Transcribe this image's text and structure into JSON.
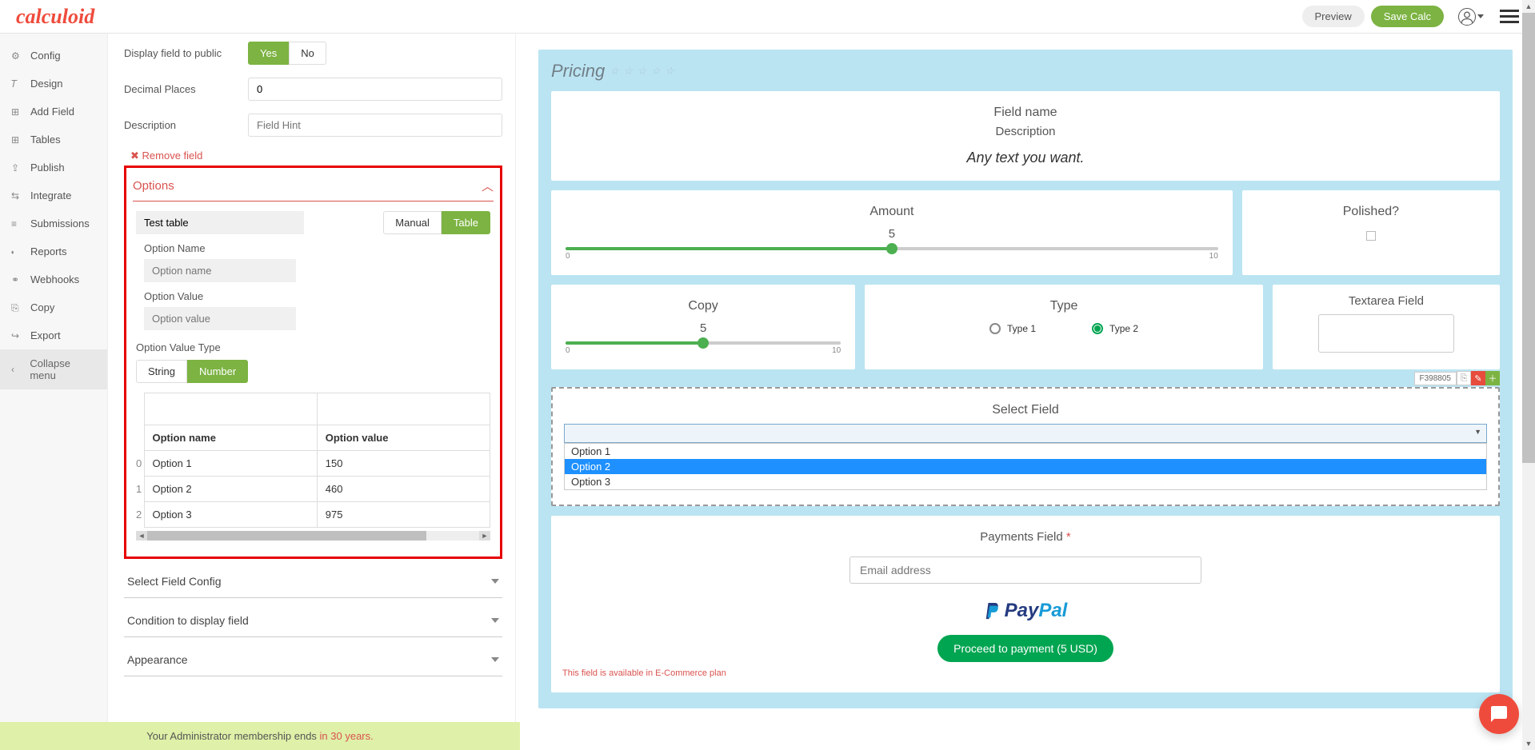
{
  "logo": "calculoid",
  "topbar": {
    "preview": "Preview",
    "save": "Save Calc"
  },
  "sidebar": {
    "items": [
      {
        "icon": "⚙",
        "label": "Config"
      },
      {
        "icon": "𝑇",
        "label": "Design"
      },
      {
        "icon": "⊞",
        "label": "Add Field"
      },
      {
        "icon": "⊞",
        "label": "Tables"
      },
      {
        "icon": "⇪",
        "label": "Publish"
      },
      {
        "icon": "⇆",
        "label": "Integrate"
      },
      {
        "icon": "≡",
        "label": "Submissions"
      },
      {
        "icon": "⬪",
        "label": "Reports"
      },
      {
        "icon": "⚭",
        "label": "Webhooks"
      },
      {
        "icon": "⎘",
        "label": "Copy"
      },
      {
        "icon": "↪",
        "label": "Export"
      }
    ],
    "collapse": "Collapse menu"
  },
  "form": {
    "display_label": "Display field to public",
    "yes": "Yes",
    "no": "No",
    "decimal_label": "Decimal Places",
    "decimal_value": "0",
    "desc_label": "Description",
    "desc_placeholder": "Field Hint",
    "remove": "Remove field"
  },
  "options": {
    "header": "Options",
    "test_placeholder": "Test table",
    "manual": "Manual",
    "table": "Table",
    "opt_name_label": "Option Name",
    "opt_name_placeholder": "Option name",
    "opt_value_label": "Option Value",
    "opt_value_placeholder": "Option value",
    "type_label": "Option Value Type",
    "string": "String",
    "number": "Number",
    "th_name": "Option name",
    "th_value": "Option value",
    "rows": [
      {
        "idx": "0",
        "name": "Option 1",
        "value": "150"
      },
      {
        "idx": "1",
        "name": "Option 2",
        "value": "460"
      },
      {
        "idx": "2",
        "name": "Option 3",
        "value": "975"
      }
    ]
  },
  "accordions": {
    "config": "Select Field Config",
    "condition": "Condition to display field",
    "appearance": "Appearance"
  },
  "membership": {
    "text": "Your Administrator membership ends ",
    "years": "in 30 years."
  },
  "preview": {
    "title": "Pricing",
    "field_name": "Field name",
    "description": "Description",
    "anytext": "Any text you want.",
    "amount_label": "Amount",
    "amount_val": "5",
    "amount_min": "0",
    "amount_max": "10",
    "polished_label": "Polished?",
    "copy_label": "Copy",
    "copy_val": "5",
    "copy_min": "0",
    "copy_max": "10",
    "type_label": "Type",
    "type1": "Type 1",
    "type2": "Type 2",
    "textarea_label": "Textarea Field",
    "select_label": "Select Field",
    "select_id": "F398805",
    "dropdown": [
      {
        "label": "Option 1",
        "hl": false
      },
      {
        "label": "Option 2",
        "hl": true
      },
      {
        "label": "Option 3",
        "hl": false
      }
    ],
    "payments_label": "Payments Field",
    "email_placeholder": "Email address",
    "paypal_pay": "Pay",
    "paypal_pal": "Pal",
    "proceed": "Proceed to payment (5 USD)",
    "ecom_note": "This field is available in E-Commerce plan"
  }
}
